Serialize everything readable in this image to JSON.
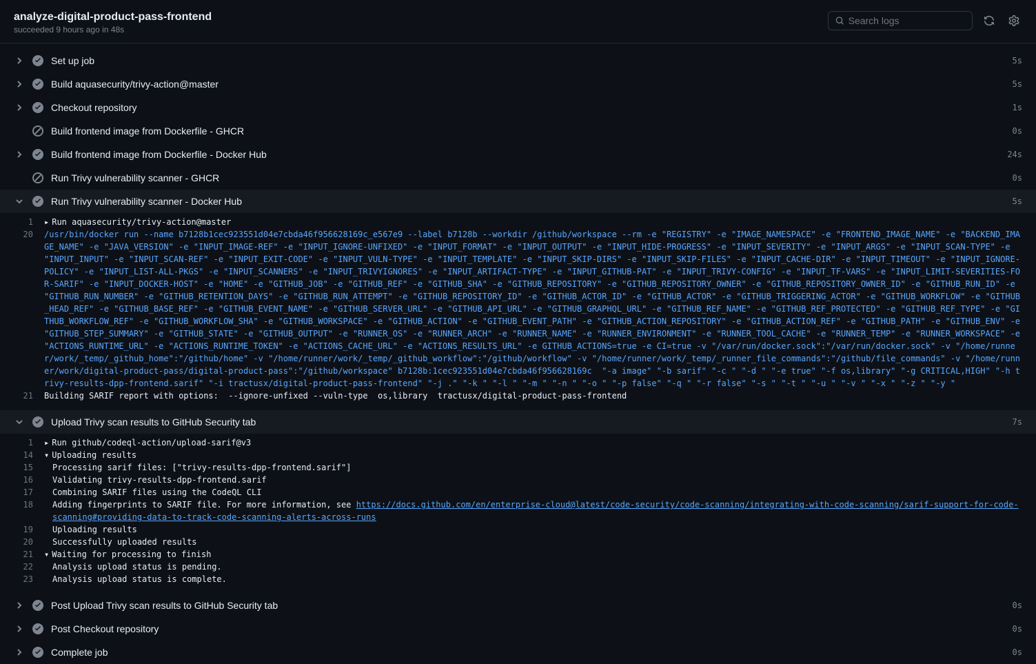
{
  "header": {
    "title": "analyze-digital-product-pass-frontend",
    "subtitle": "succeeded 9 hours ago in 48s",
    "search_placeholder": "Search logs"
  },
  "steps": [
    {
      "status": "success",
      "expandable": true,
      "expanded": false,
      "label": "Set up job",
      "duration": "5s"
    },
    {
      "status": "success",
      "expandable": true,
      "expanded": false,
      "label": "Build aquasecurity/trivy-action@master",
      "duration": "5s"
    },
    {
      "status": "success",
      "expandable": true,
      "expanded": false,
      "label": "Checkout repository",
      "duration": "1s"
    },
    {
      "status": "skipped",
      "expandable": false,
      "expanded": false,
      "label": "Build frontend image from Dockerfile - GHCR",
      "duration": "0s"
    },
    {
      "status": "success",
      "expandable": true,
      "expanded": false,
      "label": "Build frontend image from Dockerfile - Docker Hub",
      "duration": "24s"
    },
    {
      "status": "skipped",
      "expandable": false,
      "expanded": false,
      "label": "Run Trivy vulnerability scanner - GHCR",
      "duration": "0s"
    },
    {
      "status": "success",
      "expandable": true,
      "expanded": true,
      "label": "Run Trivy vulnerability scanner - Docker Hub",
      "duration": "5s"
    },
    {
      "status": "success",
      "expandable": true,
      "expanded": true,
      "label": "Upload Trivy scan results to GitHub Security tab",
      "duration": "7s"
    },
    {
      "status": "success",
      "expandable": true,
      "expanded": false,
      "label": "Post Upload Trivy scan results to GitHub Security tab",
      "duration": "0s"
    },
    {
      "status": "success",
      "expandable": true,
      "expanded": false,
      "label": "Post Checkout repository",
      "duration": "0s"
    },
    {
      "status": "success",
      "expandable": true,
      "expanded": false,
      "label": "Complete job",
      "duration": "0s"
    }
  ],
  "log_trivy": {
    "line1_num": "1",
    "line1_text": "Run aquasecurity/trivy-action@master",
    "line20_num": "20",
    "line20_text": "/usr/bin/docker run --name b7128b1cec923551d04e7cbda46f956628169c_e567e9 --label b7128b --workdir /github/workspace --rm -e \"REGISTRY\" -e \"IMAGE_NAMESPACE\" -e \"FRONTEND_IMAGE_NAME\" -e \"BACKEND_IMAGE_NAME\" -e \"JAVA_VERSION\" -e \"INPUT_IMAGE-REF\" -e \"INPUT_IGNORE-UNFIXED\" -e \"INPUT_FORMAT\" -e \"INPUT_OUTPUT\" -e \"INPUT_HIDE-PROGRESS\" -e \"INPUT_SEVERITY\" -e \"INPUT_ARGS\" -e \"INPUT_SCAN-TYPE\" -e \"INPUT_INPUT\" -e \"INPUT_SCAN-REF\" -e \"INPUT_EXIT-CODE\" -e \"INPUT_VULN-TYPE\" -e \"INPUT_TEMPLATE\" -e \"INPUT_SKIP-DIRS\" -e \"INPUT_SKIP-FILES\" -e \"INPUT_CACHE-DIR\" -e \"INPUT_TIMEOUT\" -e \"INPUT_IGNORE-POLICY\" -e \"INPUT_LIST-ALL-PKGS\" -e \"INPUT_SCANNERS\" -e \"INPUT_TRIVYIGNORES\" -e \"INPUT_ARTIFACT-TYPE\" -e \"INPUT_GITHUB-PAT\" -e \"INPUT_TRIVY-CONFIG\" -e \"INPUT_TF-VARS\" -e \"INPUT_LIMIT-SEVERITIES-FOR-SARIF\" -e \"INPUT_DOCKER-HOST\" -e \"HOME\" -e \"GITHUB_JOB\" -e \"GITHUB_REF\" -e \"GITHUB_SHA\" -e \"GITHUB_REPOSITORY\" -e \"GITHUB_REPOSITORY_OWNER\" -e \"GITHUB_REPOSITORY_OWNER_ID\" -e \"GITHUB_RUN_ID\" -e \"GITHUB_RUN_NUMBER\" -e \"GITHUB_RETENTION_DAYS\" -e \"GITHUB_RUN_ATTEMPT\" -e \"GITHUB_REPOSITORY_ID\" -e \"GITHUB_ACTOR_ID\" -e \"GITHUB_ACTOR\" -e \"GITHUB_TRIGGERING_ACTOR\" -e \"GITHUB_WORKFLOW\" -e \"GITHUB_HEAD_REF\" -e \"GITHUB_BASE_REF\" -e \"GITHUB_EVENT_NAME\" -e \"GITHUB_SERVER_URL\" -e \"GITHUB_API_URL\" -e \"GITHUB_GRAPHQL_URL\" -e \"GITHUB_REF_NAME\" -e \"GITHUB_REF_PROTECTED\" -e \"GITHUB_REF_TYPE\" -e \"GITHUB_WORKFLOW_REF\" -e \"GITHUB_WORKFLOW_SHA\" -e \"GITHUB_WORKSPACE\" -e \"GITHUB_ACTION\" -e \"GITHUB_EVENT_PATH\" -e \"GITHUB_ACTION_REPOSITORY\" -e \"GITHUB_ACTION_REF\" -e \"GITHUB_PATH\" -e \"GITHUB_ENV\" -e \"GITHUB_STEP_SUMMARY\" -e \"GITHUB_STATE\" -e \"GITHUB_OUTPUT\" -e \"RUNNER_OS\" -e \"RUNNER_ARCH\" -e \"RUNNER_NAME\" -e \"RUNNER_ENVIRONMENT\" -e \"RUNNER_TOOL_CACHE\" -e \"RUNNER_TEMP\" -e \"RUNNER_WORKSPACE\" -e \"ACTIONS_RUNTIME_URL\" -e \"ACTIONS_RUNTIME_TOKEN\" -e \"ACTIONS_CACHE_URL\" -e \"ACTIONS_RESULTS_URL\" -e GITHUB_ACTIONS=true -e CI=true -v \"/var/run/docker.sock\":\"/var/run/docker.sock\" -v \"/home/runner/work/_temp/_github_home\":\"/github/home\" -v \"/home/runner/work/_temp/_github_workflow\":\"/github/workflow\" -v \"/home/runner/work/_temp/_runner_file_commands\":\"/github/file_commands\" -v \"/home/runner/work/digital-product-pass/digital-product-pass\":\"/github/workspace\" b7128b:1cec923551d04e7cbda46f956628169c  \"-a image\" \"-b sarif\" \"-c \" \"-d \" \"-e true\" \"-f os,library\" \"-g CRITICAL,HIGH\" \"-h trivy-results-dpp-frontend.sarif\" \"-i tractusx/digital-product-pass-frontend\" \"-j .\" \"-k \" \"-l \" \"-m \" \"-n \" \"-o \" \"-p false\" \"-q \" \"-r false\" \"-s \" \"-t \" \"-u \" \"-v \" \"-x \" \"-z \" \"-y \"",
    "line21_num": "21",
    "line21_text": "Building SARIF report with options:  --ignore-unfixed --vuln-type  os,library  tractusx/digital-product-pass-frontend"
  },
  "log_upload": {
    "l1_num": "1",
    "l1_text": "Run github/codeql-action/upload-sarif@v3",
    "l14_num": "14",
    "l14_text": "Uploading results",
    "l15_num": "15",
    "l15_text": "Processing sarif files: [\"trivy-results-dpp-frontend.sarif\"]",
    "l16_num": "16",
    "l16_text": "Validating trivy-results-dpp-frontend.sarif",
    "l17_num": "17",
    "l17_text": "Combining SARIF files using the CodeQL CLI",
    "l18_num": "18",
    "l18_pre": "Adding fingerprints to SARIF file. For more information, see ",
    "l18_link": "https://docs.github.com/en/enterprise-cloud@latest/code-security/code-scanning/integrating-with-code-scanning/sarif-support-for-code-scanning#providing-data-to-track-code-scanning-alerts-across-runs",
    "l19_num": "19",
    "l19_text": "Uploading results",
    "l20_num": "20",
    "l20_text": "Successfully uploaded results",
    "l21_num": "21",
    "l21_text": "Waiting for processing to finish",
    "l22_num": "22",
    "l22_text": "Analysis upload status is pending.",
    "l23_num": "23",
    "l23_text": "Analysis upload status is complete."
  }
}
